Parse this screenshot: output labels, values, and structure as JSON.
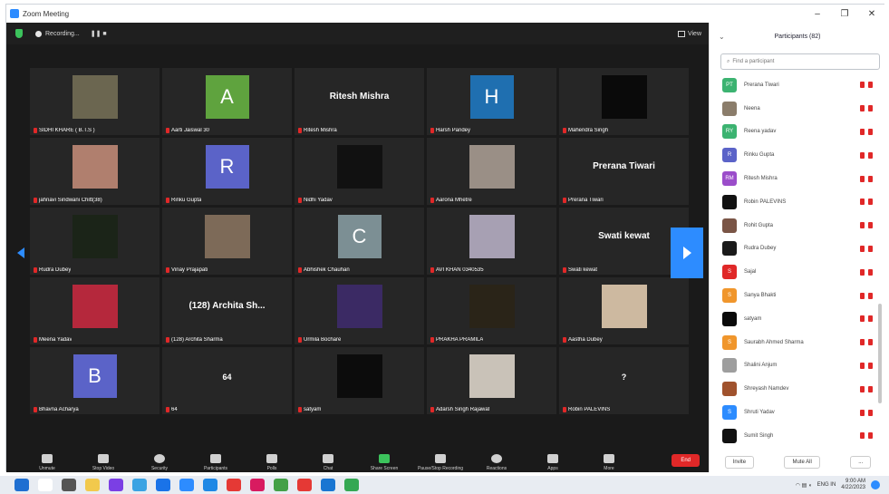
{
  "window": {
    "title": "Zoom Meeting",
    "controls": [
      "–",
      "❐",
      "✕"
    ]
  },
  "topbar": {
    "recording_label": "Recording...",
    "view_label": "View"
  },
  "tiles": [
    {
      "name": "SIDHI KHARE ( B.T.S )",
      "kind": "photo",
      "color": "#6b6650"
    },
    {
      "name": "Aarti Jaiswal 30",
      "kind": "letter",
      "letter": "A",
      "color": "#5fa33e"
    },
    {
      "name": "Ritesh Mishra",
      "kind": "text",
      "big": "Ritesh Mishra"
    },
    {
      "name": "Harsh Pandey",
      "kind": "letter",
      "letter": "H",
      "color": "#1f6fb0"
    },
    {
      "name": "Mahendra Singh",
      "kind": "photo",
      "color": "#0a0a0a"
    },
    {
      "name": "jahnavi Sindwani Chitt(38)",
      "kind": "photo",
      "color": "#b07f6e"
    },
    {
      "name": "Rinku Gupta",
      "kind": "letter",
      "letter": "R",
      "color": "#5b63c8"
    },
    {
      "name": "Nidhi Yadav",
      "kind": "photo",
      "color": "#111111"
    },
    {
      "name": "Aarona Mhetre",
      "kind": "photo",
      "color": "#9a8f86"
    },
    {
      "name": "Prerana Tiwari",
      "kind": "text",
      "big": "Prerana Tiwari"
    },
    {
      "name": "Rudra Dubey",
      "kind": "photo",
      "color": "#1b2418"
    },
    {
      "name": "Vinay Prajapati",
      "kind": "photo",
      "color": "#7d6a58"
    },
    {
      "name": "Abhishek Chauhan",
      "kind": "letter",
      "letter": "C",
      "color": "#7c8f94"
    },
    {
      "name": "AVI KHAN 0340535",
      "kind": "photo",
      "color": "#a7a0b3"
    },
    {
      "name": "Swati kewat",
      "kind": "text",
      "big": "Swati kewat"
    },
    {
      "name": "Meena Yadav",
      "kind": "photo",
      "color": "#b5283c"
    },
    {
      "name": "(128) Archita Sharma",
      "kind": "text",
      "big": "(128) Archita Sh..."
    },
    {
      "name": "Urmila Bochare",
      "kind": "photo",
      "color": "#3b2a64"
    },
    {
      "name": "PRAKHA PRAMILA",
      "kind": "photo",
      "color": "#2a2418"
    },
    {
      "name": "Aastha Dubey",
      "kind": "photo",
      "color": "#cdb9a0"
    },
    {
      "name": "Bhavna Acharya",
      "kind": "letter",
      "letter": "B",
      "color": "#5b63c8"
    },
    {
      "name": "64",
      "kind": "num",
      "big": "64"
    },
    {
      "name": "satyam",
      "kind": "photo",
      "color": "#0c0c0c"
    },
    {
      "name": "Adarsh Singh Rajawat",
      "kind": "photo",
      "color": "#c9c2b8"
    },
    {
      "name": "Robin PALEVINS",
      "kind": "num",
      "big": "?"
    }
  ],
  "toolbar": {
    "items": [
      {
        "label": "Unmute",
        "name": "unmute"
      },
      {
        "label": "Stop Video",
        "name": "stop-video"
      },
      {
        "label": "Security",
        "name": "security"
      },
      {
        "label": "Participants",
        "name": "participants"
      },
      {
        "label": "Polls",
        "name": "polls"
      },
      {
        "label": "Chat",
        "name": "chat"
      },
      {
        "label": "Share Screen",
        "name": "share-screen"
      },
      {
        "label": "Pause/Stop Recording",
        "name": "recording"
      },
      {
        "label": "Reactions",
        "name": "reactions"
      },
      {
        "label": "Apps",
        "name": "apps"
      },
      {
        "label": "More",
        "name": "more"
      }
    ],
    "end_label": "End"
  },
  "panel": {
    "title": "Participants (82)",
    "search_placeholder": "Find a participant",
    "participants": [
      {
        "name": "Prerana Tiwari",
        "initials": "PT",
        "color": "#3cb371"
      },
      {
        "name": "Neena",
        "initials": "",
        "color": "#8b7d6b"
      },
      {
        "name": "Reena yadav",
        "initials": "RY",
        "color": "#3cb371"
      },
      {
        "name": "Rinku Gupta",
        "initials": "R",
        "color": "#5b63c8"
      },
      {
        "name": "Ritesh Mishra",
        "initials": "RM",
        "color": "#9b4dca"
      },
      {
        "name": "Robin PALEVINS",
        "initials": "",
        "color": "#111111"
      },
      {
        "name": "Rohit Gupta",
        "initials": "",
        "color": "#7a5546"
      },
      {
        "name": "Rudra Dubey",
        "initials": "",
        "color": "#1a1a1a"
      },
      {
        "name": "Sajal",
        "initials": "S",
        "color": "#e02828"
      },
      {
        "name": "Sanya Bhakti",
        "initials": "S",
        "color": "#f0962c"
      },
      {
        "name": "satyam",
        "initials": "",
        "color": "#0a0a0a"
      },
      {
        "name": "Saurabh Ahmed Sharma",
        "initials": "S",
        "color": "#f0962c"
      },
      {
        "name": "Shalini Anjum",
        "initials": "",
        "color": "#9e9e9e"
      },
      {
        "name": "Shreyash Namdev",
        "initials": "",
        "color": "#a0522d"
      },
      {
        "name": "Shruti Yadav",
        "initials": "S",
        "color": "#2d8cff"
      },
      {
        "name": "Sumit Singh",
        "initials": "",
        "color": "#111111"
      }
    ],
    "invite_label": "Invite",
    "mute_all_label": "Mute All",
    "more_label": "..."
  },
  "taskbar": {
    "apps": [
      "#1f6fd1",
      "#ffffff",
      "#555555",
      "#f2c94c",
      "#7b3fe4",
      "#3aa3e3",
      "#1a73e8",
      "#2d8cff",
      "#1e88e5",
      "#e53935",
      "#d81b60",
      "#43a047",
      "#e53935",
      "#1976d2",
      "#34a853"
    ],
    "tray_lang": "ENG IN",
    "time": "9:00 AM",
    "date": "4/22/2023"
  }
}
